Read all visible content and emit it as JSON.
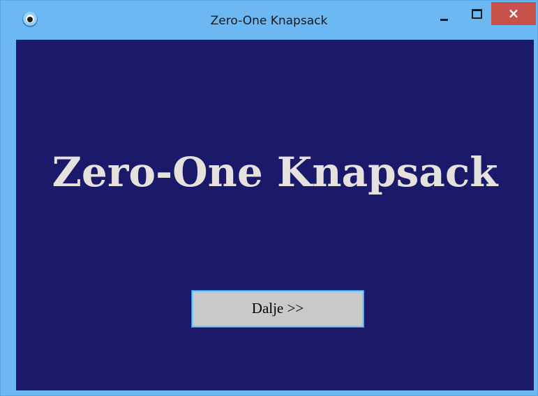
{
  "window": {
    "title": "Zero-One Knapsack",
    "close_label": "×"
  },
  "main": {
    "heading": "Zero-One Knapsack",
    "next_button_label": "Dalje >>"
  },
  "colors": {
    "client_background": "#1a196a",
    "titlebar": "#6cb8f2",
    "close_button": "#c7504a",
    "heading_text": "#e6e1dd",
    "button_face": "#c9c9c9"
  }
}
